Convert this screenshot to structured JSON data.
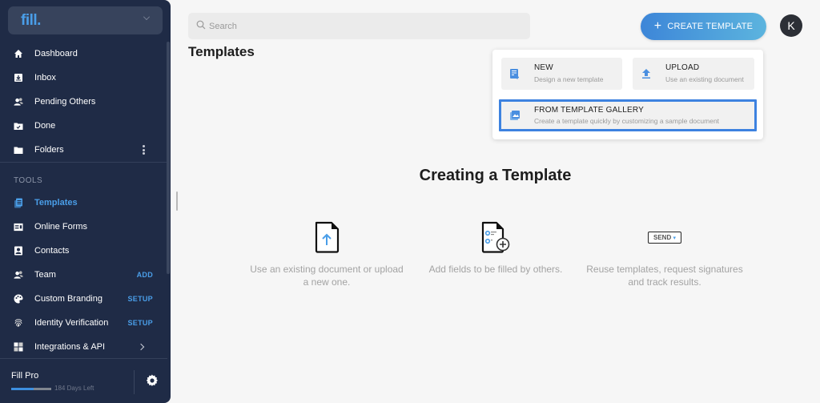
{
  "brand": {
    "logo_text": "fill."
  },
  "sidebar": {
    "items": [
      {
        "label": "Dashboard",
        "icon": "home-icon"
      },
      {
        "label": "Inbox",
        "icon": "inbox-icon"
      },
      {
        "label": "Pending Others",
        "icon": "users-icon"
      },
      {
        "label": "Done",
        "icon": "folder-check-icon"
      },
      {
        "label": "Folders",
        "icon": "folder-icon"
      }
    ],
    "tools_label": "TOOLS",
    "tools": [
      {
        "label": "Templates",
        "icon": "templates-icon",
        "active": true
      },
      {
        "label": "Online Forms",
        "icon": "form-icon"
      },
      {
        "label": "Contacts",
        "icon": "contact-icon"
      },
      {
        "label": "Team",
        "icon": "team-icon",
        "badge": "ADD"
      },
      {
        "label": "Custom Branding",
        "icon": "palette-icon",
        "badge": "SETUP"
      },
      {
        "label": "Identity Verification",
        "icon": "fingerprint-icon",
        "badge": "SETUP"
      },
      {
        "label": "Integrations & API",
        "icon": "puzzle-icon"
      }
    ],
    "plan": {
      "name": "Fill Pro",
      "days_left": "184 Days Left",
      "progress_percent": 55
    }
  },
  "header": {
    "search_placeholder": "Search",
    "create_button": "CREATE TEMPLATE",
    "avatar_initial": "K"
  },
  "page_title": "Templates",
  "dropdown": {
    "options": [
      {
        "title": "NEW",
        "desc": "Design a new template"
      },
      {
        "title": "UPLOAD",
        "desc": "Use an existing document"
      },
      {
        "title": "FROM TEMPLATE GALLERY",
        "desc": "Create a template quickly by customizing a sample document"
      }
    ]
  },
  "empty_state": {
    "title": "Creating a Template",
    "steps": [
      {
        "text": "Use an existing document or upload a new one."
      },
      {
        "text": "Add fields to be filled by others."
      },
      {
        "text": "Reuse templates, request signatures and track results.",
        "badge": "SEND"
      }
    ]
  },
  "colors": {
    "accent": "#4a9ee8",
    "sidebar_bg": "#1f2b46",
    "highlight_border": "#3d82e0"
  }
}
